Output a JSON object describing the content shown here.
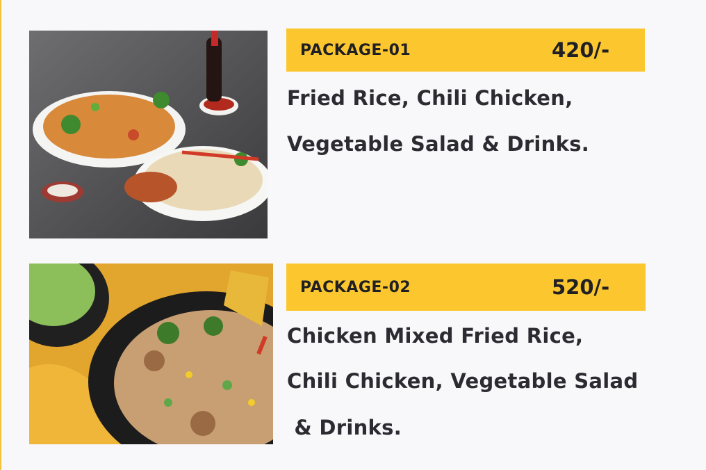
{
  "packages": [
    {
      "name": "PACKAGE-01",
      "price": "420/-",
      "description_lines": [
        "Fried Rice, Chili Chicken,",
        "Vegetable Salad & Drinks."
      ]
    },
    {
      "name": "PACKAGE-02",
      "price": "520/-",
      "description_lines": [
        "Chicken Mixed Fried Rice,",
        "Chili Chicken, Vegetable Salad",
        " & Drinks."
      ]
    }
  ],
  "colors": {
    "accent": "#fcc72e",
    "background": "#f8f8fa",
    "text": "#2b2b31"
  }
}
